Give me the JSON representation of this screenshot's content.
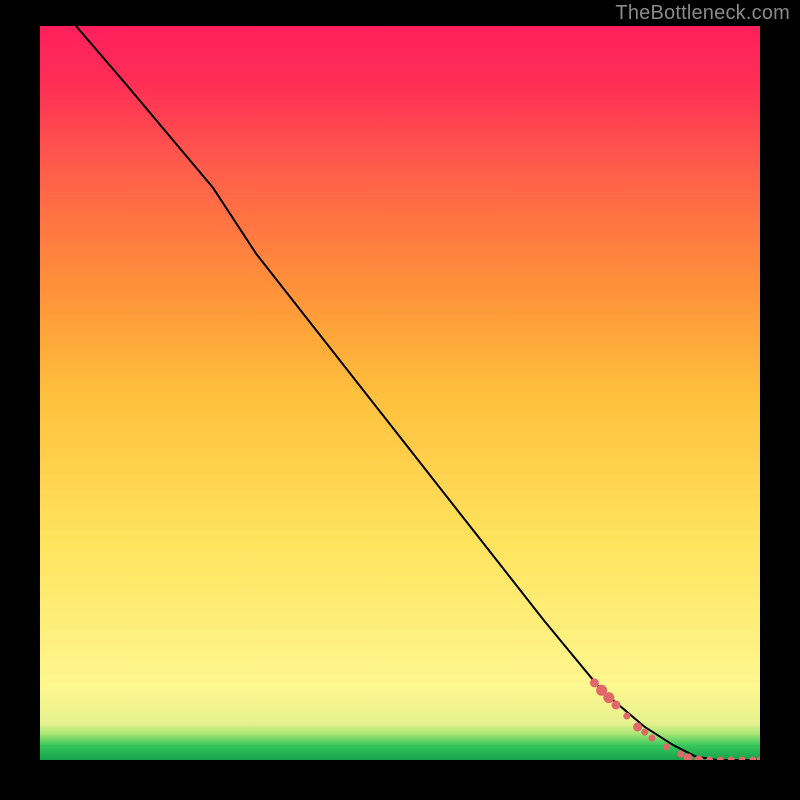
{
  "attribution": "TheBottleneck.com",
  "colors": {
    "background": "#000000",
    "gradient_top": "#ff1f5d",
    "gradient_mid": "#ffe35d",
    "gradient_bottom": "#13a24b",
    "line": "#000000",
    "points": "#e06868"
  },
  "chart_data": {
    "type": "line",
    "title": "",
    "xlabel": "",
    "ylabel": "",
    "x_range": [
      0,
      100
    ],
    "y_range": [
      0,
      100
    ],
    "description": "Descending curve from top-left to bottom-right with a slight knee near x≈25, flattening to y=0 past x≈90. Scatter points cluster along the lower-right segment of the line.",
    "series": [
      {
        "name": "curve",
        "kind": "line",
        "x": [
          5,
          12,
          18,
          24,
          30,
          40,
          50,
          60,
          70,
          78,
          84,
          88,
          91,
          94,
          97,
          100
        ],
        "y": [
          100,
          92,
          85,
          78,
          69,
          56.5,
          44,
          31.5,
          19,
          9.5,
          4.5,
          2,
          0.5,
          0,
          0,
          0
        ]
      },
      {
        "name": "points",
        "kind": "scatter",
        "points": [
          {
            "x": 77,
            "y": 10.5,
            "r": 4
          },
          {
            "x": 78,
            "y": 9.5,
            "r": 5
          },
          {
            "x": 79,
            "y": 8.5,
            "r": 5
          },
          {
            "x": 80,
            "y": 7.5,
            "r": 4
          },
          {
            "x": 81.5,
            "y": 6,
            "r": 3
          },
          {
            "x": 83,
            "y": 4.5,
            "r": 4
          },
          {
            "x": 84,
            "y": 3.8,
            "r": 3
          },
          {
            "x": 85,
            "y": 3,
            "r": 3
          },
          {
            "x": 87,
            "y": 1.8,
            "r": 3
          },
          {
            "x": 89,
            "y": 0.8,
            "r": 3
          },
          {
            "x": 90,
            "y": 0.3,
            "r": 4
          },
          {
            "x": 91.5,
            "y": 0,
            "r": 4
          },
          {
            "x": 93,
            "y": 0,
            "r": 3
          },
          {
            "x": 94.5,
            "y": 0,
            "r": 3
          },
          {
            "x": 96,
            "y": 0,
            "r": 3
          },
          {
            "x": 97.5,
            "y": 0,
            "r": 3
          },
          {
            "x": 99,
            "y": 0,
            "r": 3
          },
          {
            "x": 100,
            "y": 0,
            "r": 3
          }
        ]
      }
    ]
  }
}
